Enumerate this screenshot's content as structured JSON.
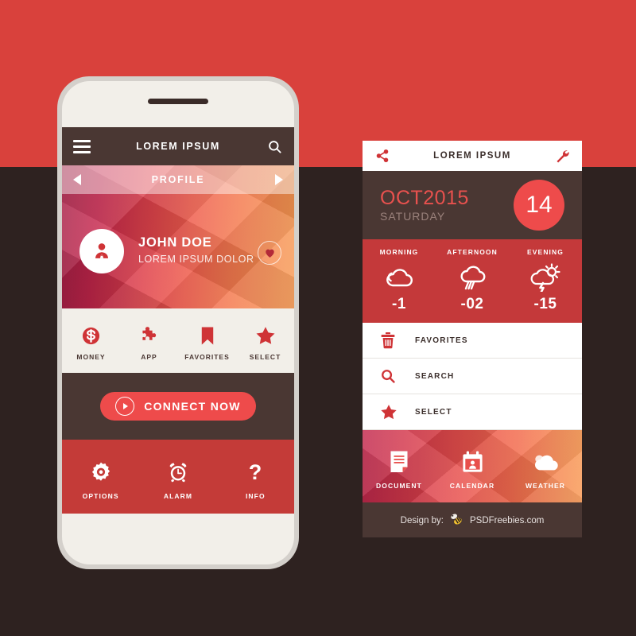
{
  "colors": {
    "bg_top": "#d9413c",
    "bg_bottom": "#2e2220",
    "dark_brown": "#4a3733",
    "accent_red": "#ee4b4b",
    "brand_red": "#c4393a",
    "cream": "#f2efe9"
  },
  "phone": {
    "appbar": {
      "menu_icon": "hamburger-menu-icon",
      "title": "LOREM IPSUM",
      "search_icon": "search-icon"
    },
    "profile_bar": {
      "prev_icon": "arrow-left-icon",
      "title": "PROFILE",
      "next_icon": "arrow-right-icon"
    },
    "hero": {
      "avatar_icon": "user-avatar-icon",
      "name": "JOHN DOE",
      "subtitle": "LOREM IPSUM DOLOR",
      "favorite_icon": "heart-icon"
    },
    "quick_icons": [
      {
        "icon": "money-icon",
        "label": "MONEY"
      },
      {
        "icon": "puzzle-app-icon",
        "label": "APP"
      },
      {
        "icon": "bookmark-icon",
        "label": "FAVORITES"
      },
      {
        "icon": "star-icon",
        "label": "SELECT"
      }
    ],
    "connect": {
      "icon": "play-circle-icon",
      "label": "CONNECT NOW"
    },
    "tools": [
      {
        "icon": "gear-icon",
        "label": "OPTIONS"
      },
      {
        "icon": "alarm-clock-icon",
        "label": "ALARM"
      },
      {
        "icon": "question-mark-icon",
        "label": "INFO"
      }
    ]
  },
  "panel": {
    "header": {
      "share_icon": "share-icon",
      "title": "LOREM IPSUM",
      "settings_icon": "wrench-icon"
    },
    "date": {
      "month_year": "OCT2015",
      "weekday": "SATURDAY",
      "day_number": "14"
    },
    "weather": [
      {
        "period": "MORNING",
        "icon": "cloud-icon",
        "temp": "-1"
      },
      {
        "period": "AFTERNOON",
        "icon": "rain-cloud-icon",
        "temp": "-02"
      },
      {
        "period": "EVENING",
        "icon": "storm-sun-cloud-icon",
        "temp": "-15"
      }
    ],
    "list": [
      {
        "icon": "trash-icon",
        "label": "FAVORITES"
      },
      {
        "icon": "search-icon",
        "label": "SEARCH"
      },
      {
        "icon": "star-icon",
        "label": "SELECT"
      }
    ],
    "footer_tiles": [
      {
        "icon": "document-icon",
        "label": "DOCUMENT"
      },
      {
        "icon": "calendar-icon",
        "label": "CALENDAR"
      },
      {
        "icon": "cloud-icon",
        "label": "WEATHER"
      }
    ],
    "credit": {
      "prefix": "Design by:",
      "bee_icon": "bee-icon",
      "site": "PSDFreebies.com"
    }
  }
}
